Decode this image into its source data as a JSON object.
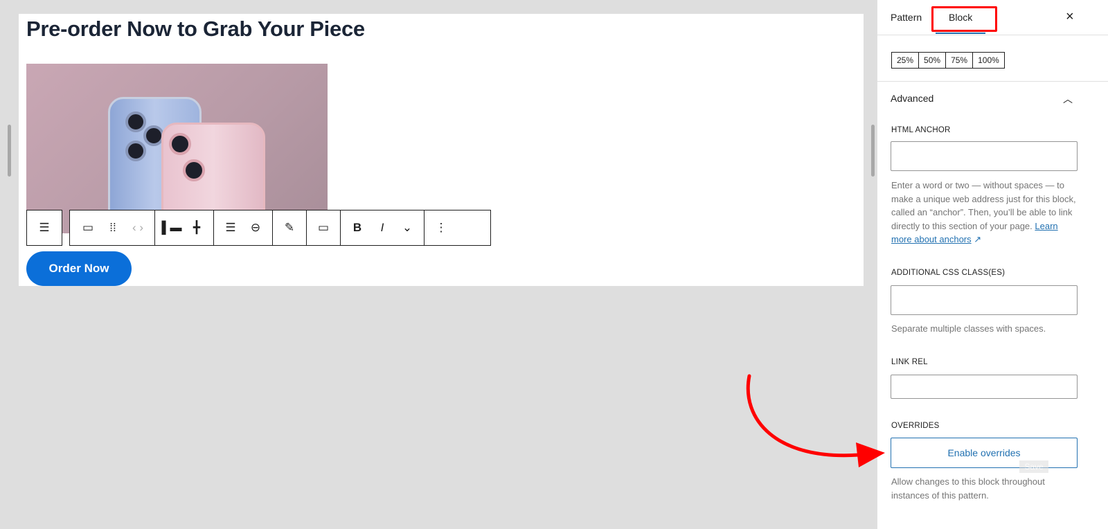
{
  "editor": {
    "heading": "Pre-order Now to Grab Your Piece",
    "button_label": "Order Now",
    "toolbar": {
      "icons": [
        "parent-block-icon",
        "button-icon",
        "drag-handle-icon",
        "move-arrows-icon",
        "align-left-icon",
        "justify-icon",
        "text-align-icon",
        "link-icon",
        "highlight-icon",
        "comment-icon",
        "bold-icon",
        "italic-icon",
        "more-formats-chevron-icon",
        "options-icon"
      ],
      "bold": "B",
      "italic": "I"
    }
  },
  "sidebar": {
    "tabs": [
      {
        "label": "Pattern"
      },
      {
        "label": "Block",
        "active": true
      }
    ],
    "close": "×",
    "width_options": [
      "25%",
      "50%",
      "75%",
      "100%"
    ],
    "advanced": {
      "title": "Advanced",
      "html_anchor": {
        "label": "HTML ANCHOR",
        "value": "",
        "help": "Enter a word or two — without spaces — to make a unique web address just for this block, called an “anchor”. Then, you’ll be able to link directly to this section of your page.",
        "link": "Learn more about anchors",
        "link_icon": "↗"
      },
      "css_classes": {
        "label": "ADDITIONAL CSS CLASS(ES)",
        "value": "",
        "help": "Separate multiple classes with spaces."
      },
      "link_rel": {
        "label": "LINK REL",
        "value": ""
      },
      "overrides": {
        "label": "OVERRIDES",
        "button": "Enable overrides",
        "help": "Allow changes to this block throughout instances of this pattern.",
        "tooltip": "Save"
      }
    }
  },
  "colors": {
    "accent": "#0b6fd9",
    "link": "#2271b1",
    "annotation": "#ff0000"
  }
}
